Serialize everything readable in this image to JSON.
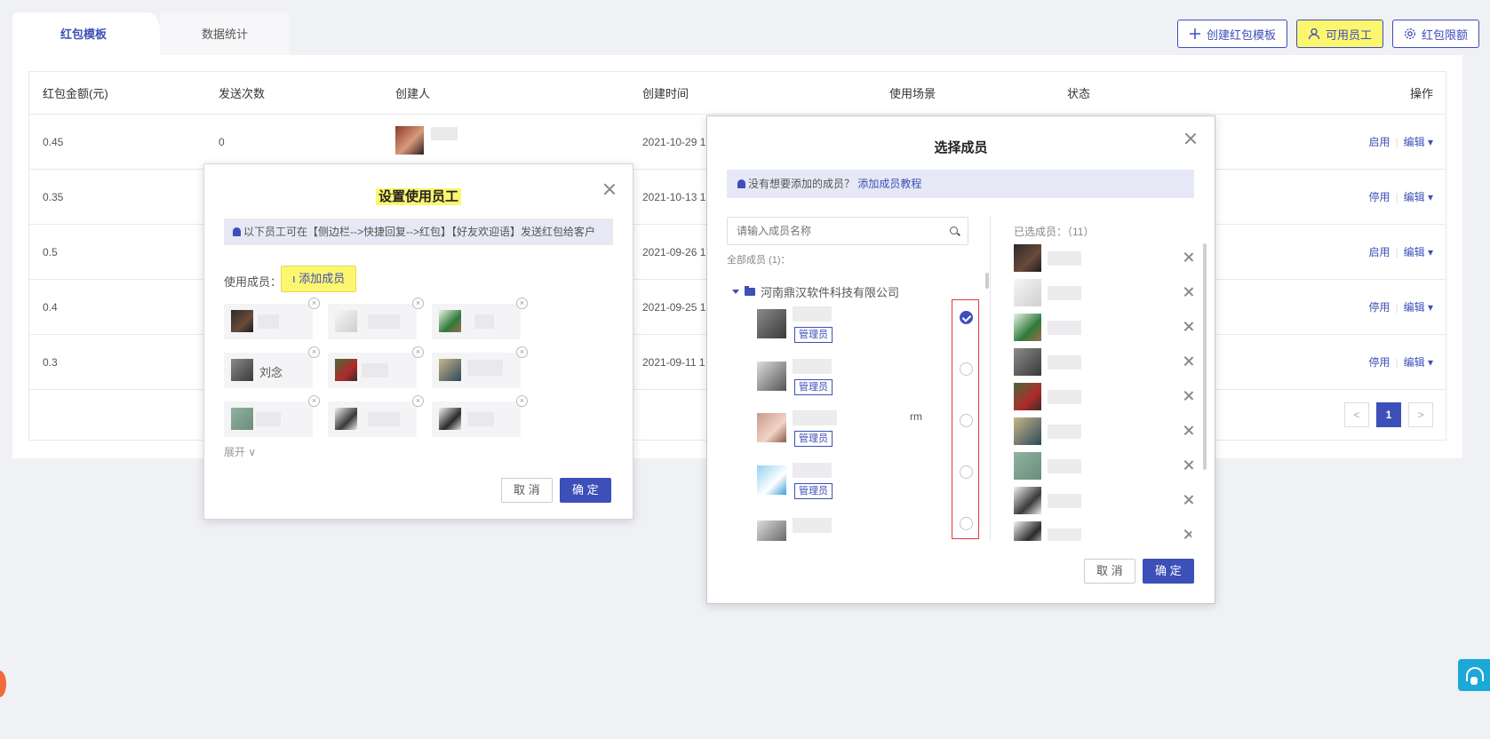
{
  "tabs": [
    {
      "label": "红包模板"
    },
    {
      "label": "数据统计"
    }
  ],
  "top_buttons": {
    "create": "创建红包模板",
    "staff": "可用员工",
    "limit": "红包限额"
  },
  "table": {
    "headers": {
      "amount": "红包金额(元)",
      "count": "发送次数",
      "creator": "创建人",
      "created": "创建时间",
      "scene": "使用场景",
      "status": "状态",
      "ops": "操作"
    },
    "rows": [
      {
        "amount": "0.45",
        "count": "0",
        "created": "2021-10-29 1",
        "toggle": "启用",
        "edit": "编辑 ▾"
      },
      {
        "amount": "0.35",
        "count": "",
        "created": "2021-10-13 1",
        "toggle": "停用",
        "edit": "编辑 ▾"
      },
      {
        "amount": "0.5",
        "count": "",
        "created": "2021-09-26 1",
        "toggle": "启用",
        "edit": "编辑 ▾"
      },
      {
        "amount": "0.4",
        "count": "",
        "created": "2021-09-25 1",
        "toggle": "停用",
        "edit": "编辑 ▾"
      },
      {
        "amount": "0.3",
        "count": "",
        "created": "2021-09-11 1",
        "toggle": "停用",
        "edit": "编辑 ▾"
      }
    ],
    "pager": {
      "prev": "<",
      "current": "1",
      "next": ">"
    }
  },
  "dialog_staff": {
    "title": "设置使用员工",
    "notice": "以下员工可在【侧边栏-->快捷回复-->红包】【好友欢迎语】发送红包给客户",
    "members_label": "使用成员：",
    "add_button": "ı 添加成员",
    "named_member": "刘念",
    "expand": "展开 ∨",
    "cancel": "取 消",
    "ok": "确 定"
  },
  "dialog_select": {
    "title": "选择成员",
    "notice": "没有想要添加的成员？",
    "notice_link": "添加成员教程",
    "search_placeholder": "请输入成员名称",
    "all_members": "全部成员 (1)：",
    "org": "河南鼎汉软件科技有限公司",
    "admin_tag": "管理员",
    "member_suffix": "rm",
    "selected_label": "已选成员：（11）",
    "cancel": "取 消",
    "ok": "确 定"
  }
}
